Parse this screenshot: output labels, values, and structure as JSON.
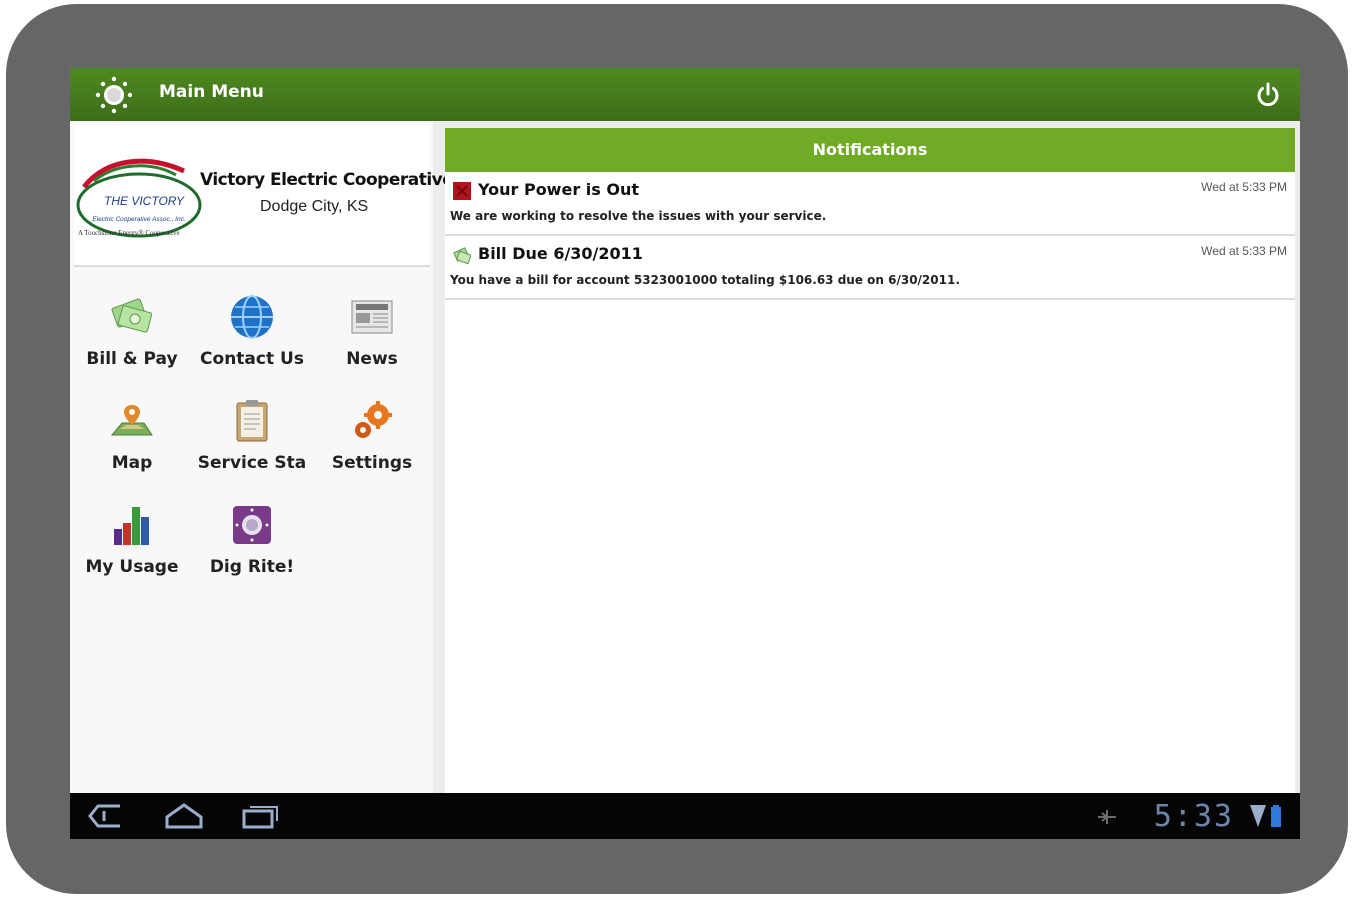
{
  "app": {
    "title": "Main Menu"
  },
  "org": {
    "name": "Victory Electric Cooperative",
    "city": "Dodge City, KS"
  },
  "logo": {
    "top_text": "THE VICTORY",
    "sub_text": "Electric Cooperative Assoc., Inc.",
    "tagline": "A Touchstone Energy® Cooperative"
  },
  "menu": [
    {
      "label": "Bill & Pay",
      "icon": "money-icon"
    },
    {
      "label": "Contact Us",
      "icon": "globe-icon"
    },
    {
      "label": "News",
      "icon": "newspaper-icon"
    },
    {
      "label": "Map",
      "icon": "map-icon"
    },
    {
      "label": "Service Sta",
      "icon": "clipboard-icon"
    },
    {
      "label": "Settings",
      "icon": "gears-icon"
    },
    {
      "label": "My Usage",
      "icon": "bar-chart-icon"
    },
    {
      "label": "Dig Rite!",
      "icon": "dial-icon"
    }
  ],
  "notifications": {
    "header": "Notifications",
    "items": [
      {
        "title": "Your Power is Out",
        "time": "Wed at 5:33 PM",
        "body": "We are working to resolve the issues with your service.",
        "icon": "power-out-icon"
      },
      {
        "title": "Bill Due 6/30/2011",
        "time": "Wed at 5:33 PM",
        "body": "You have a bill for account 5323001000 totaling $106.63 due on 6/30/2011.",
        "icon": "bill-icon"
      }
    ]
  },
  "status": {
    "clock": "5:33"
  },
  "colors": {
    "actionbar": "#4f8a20",
    "notif_header": "#6fab24",
    "frame": "#666666",
    "clock": "#6c87ad"
  }
}
